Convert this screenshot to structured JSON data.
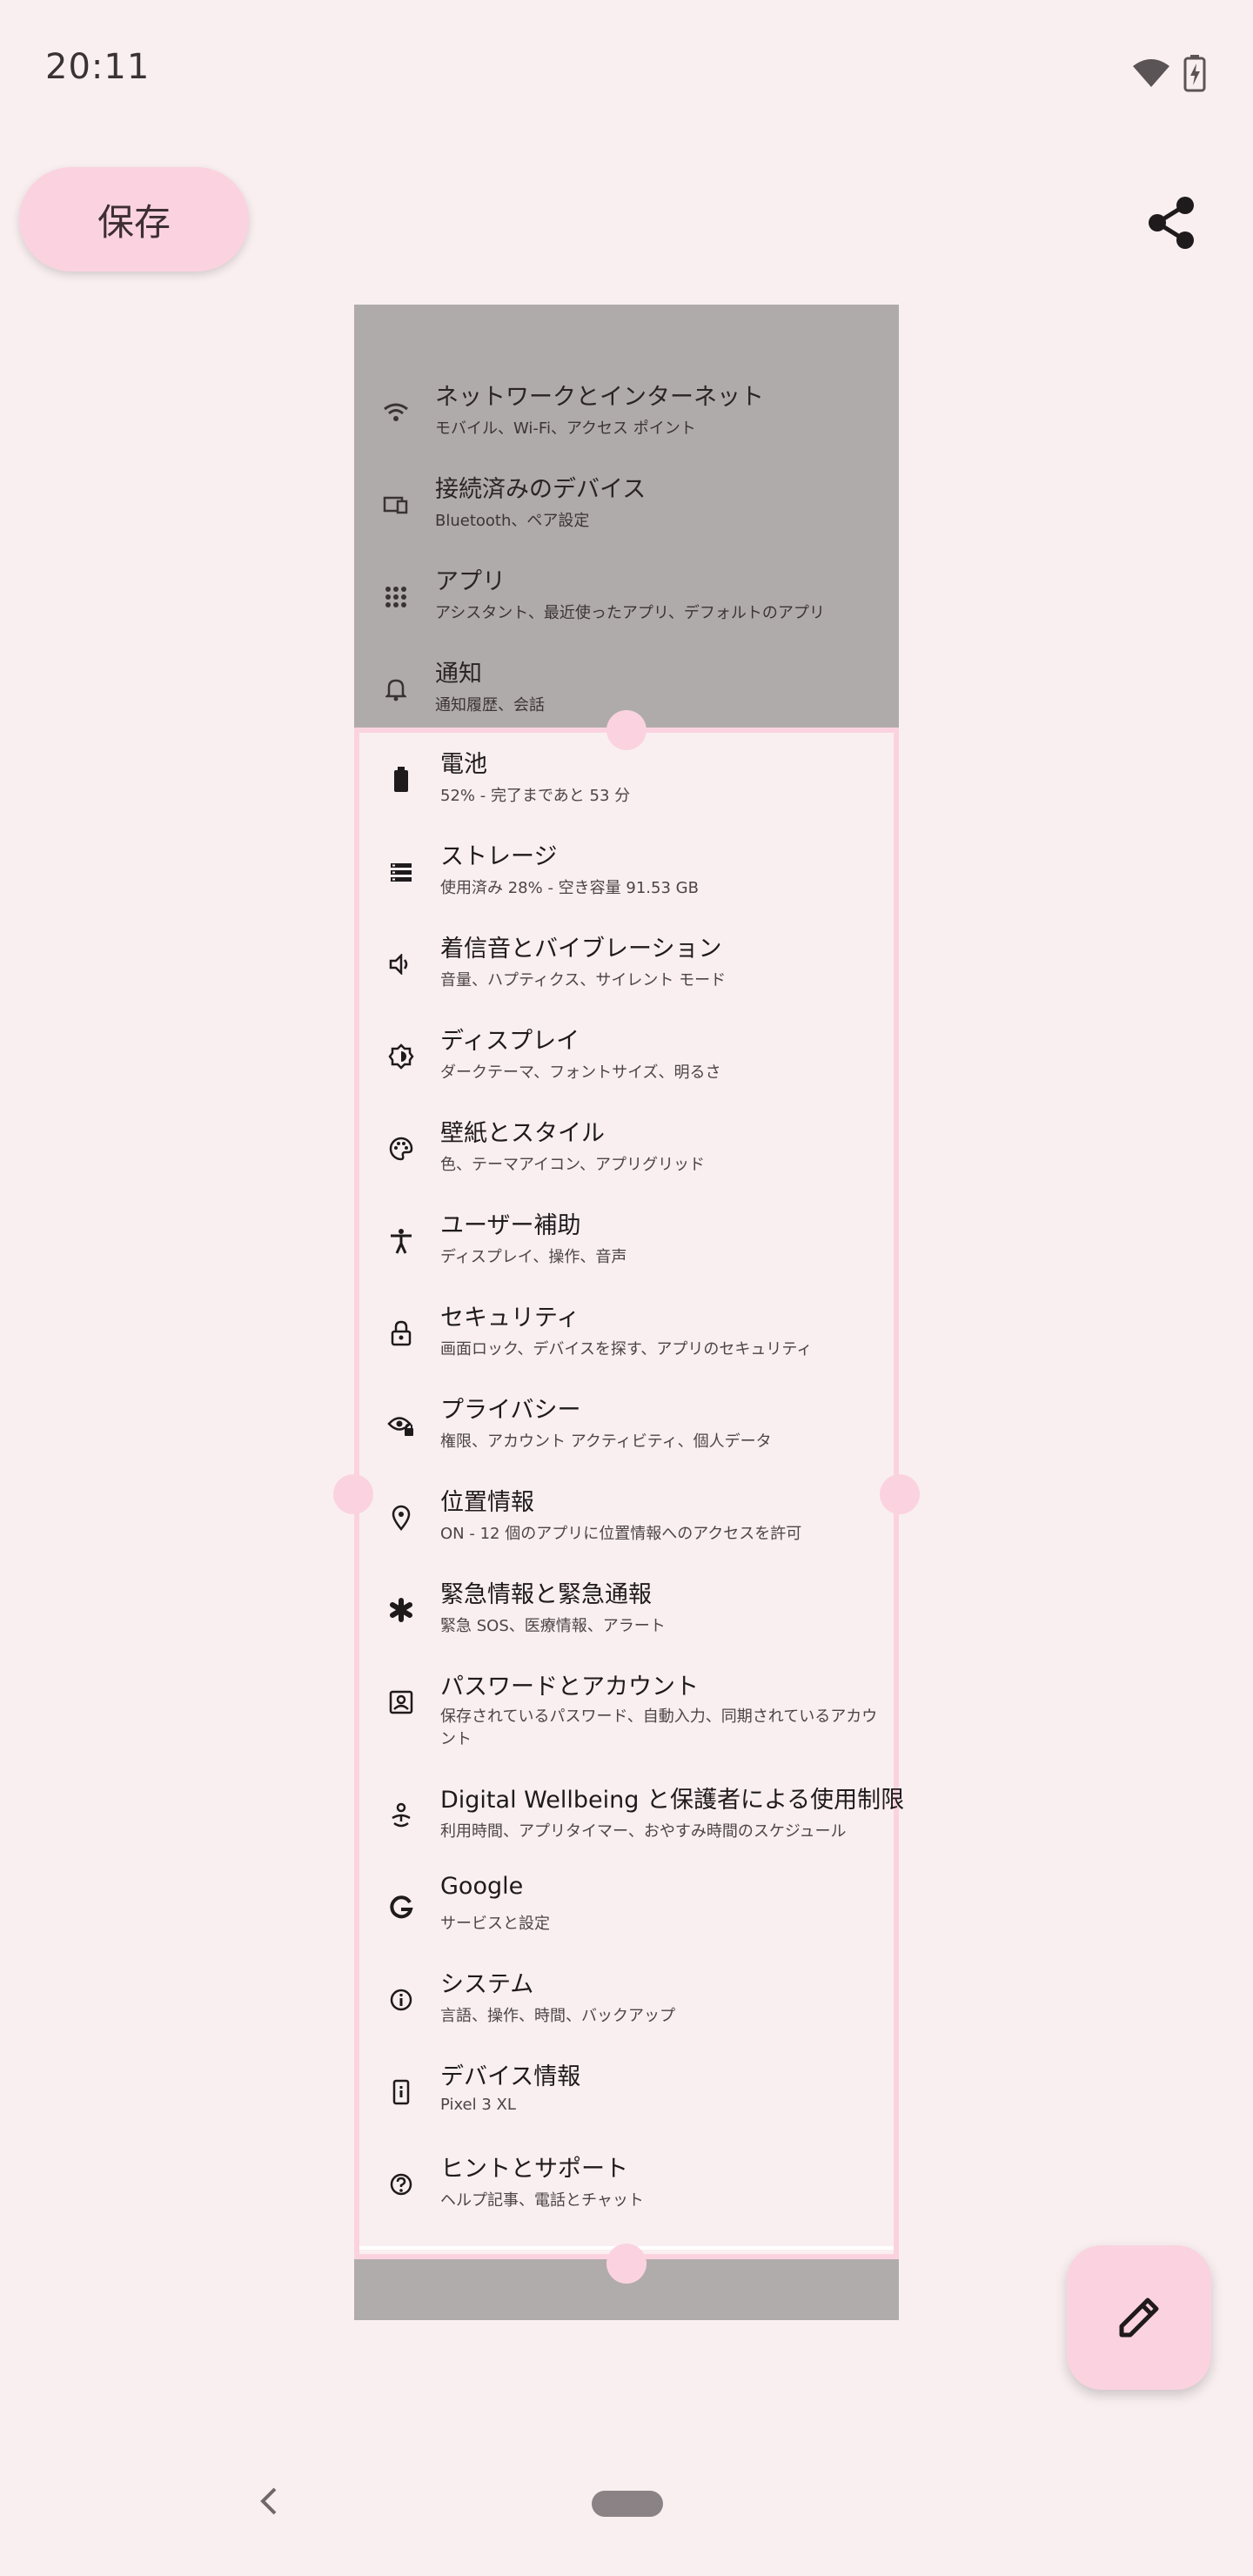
{
  "status_bar": {
    "time": "20:11"
  },
  "toolbar": {
    "save_label": "保存",
    "share_icon": "share-icon"
  },
  "dimmed_items": [
    {
      "icon": "wifi-icon",
      "title": "ネットワークとインターネット",
      "subtitle": "モバイル、Wi-Fi、アクセス ポイント"
    },
    {
      "icon": "devices-icon",
      "title": "接続済みのデバイス",
      "subtitle": "Bluetooth、ペア設定"
    },
    {
      "icon": "apps-grid-icon",
      "title": "アプリ",
      "subtitle": "アシスタント、最近使ったアプリ、デフォルトのアプリ"
    },
    {
      "icon": "bell-icon",
      "title": "通知",
      "subtitle": "通知履歴、会話"
    }
  ],
  "items": [
    {
      "icon": "battery-icon",
      "title": "電池",
      "subtitle": "52% - 完了まであと 53 分"
    },
    {
      "icon": "storage-icon",
      "title": "ストレージ",
      "subtitle": "使用済み 28% - 空き容量 91.53 GB"
    },
    {
      "icon": "volume-icon",
      "title": "着信音とバイブレーション",
      "subtitle": "音量、ハプティクス、サイレント モード"
    },
    {
      "icon": "brightness-icon",
      "title": "ディスプレイ",
      "subtitle": "ダークテーマ、フォントサイズ、明るさ"
    },
    {
      "icon": "palette-icon",
      "title": "壁紙とスタイル",
      "subtitle": "色、テーマアイコン、アプリグリッド"
    },
    {
      "icon": "accessibility-icon",
      "title": "ユーザー補助",
      "subtitle": "ディスプレイ、操作、音声"
    },
    {
      "icon": "lock-icon",
      "title": "セキュリティ",
      "subtitle": "画面ロック、デバイスを探す、アプリのセキュリティ"
    },
    {
      "icon": "privacy-eye-icon",
      "title": "プライバシー",
      "subtitle": "権限、アカウント アクティビティ、個人データ"
    },
    {
      "icon": "location-pin-icon",
      "title": "位置情報",
      "subtitle": "ON - 12 個のアプリに位置情報へのアクセスを許可"
    },
    {
      "icon": "emergency-asterisk-icon",
      "title": "緊急情報と緊急通報",
      "subtitle": "緊急 SOS、医療情報、アラート"
    },
    {
      "icon": "account-box-icon",
      "title": "パスワードとアカウント",
      "subtitle": "保存されているパスワード、自動入力、同期されているアカウント"
    },
    {
      "icon": "wellbeing-icon",
      "title": "Digital Wellbeing と保護者による使用制限",
      "subtitle": "利用時間、アプリタイマー、おやすみ時間のスケジュール"
    },
    {
      "icon": "google-g-icon",
      "title": "Google",
      "subtitle": "サービスと設定"
    },
    {
      "icon": "info-icon",
      "title": "システム",
      "subtitle": "言語、操作、時間、バックアップ"
    },
    {
      "icon": "phone-info-icon",
      "title": "デバイス情報",
      "subtitle": "Pixel 3 XL"
    },
    {
      "icon": "help-icon",
      "title": "ヒントとサポート",
      "subtitle": "ヘルプ記事、電話とチャット"
    }
  ],
  "fab": {
    "icon": "pencil-icon"
  },
  "nav": {
    "back_icon": "back-chevron-icon",
    "home_icon": "home-pill"
  }
}
